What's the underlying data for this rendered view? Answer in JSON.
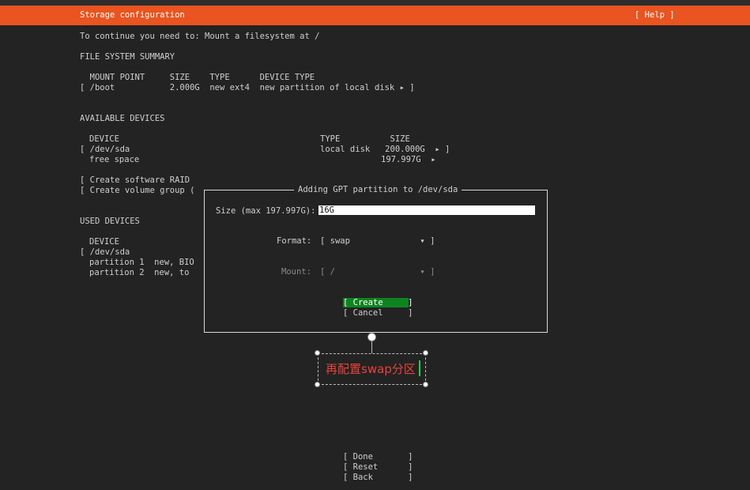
{
  "header": {
    "title": "Storage configuration",
    "help": "[ Help ]"
  },
  "message": "To continue you need to: Mount a filesystem at /",
  "fs_summary": {
    "heading": "FILE SYSTEM SUMMARY",
    "columns": "  MOUNT POINT     SIZE    TYPE      DEVICE TYPE",
    "rows": [
      "[ /boot           2.000G  new ext4  new partition of local disk ▸ ]"
    ]
  },
  "available": {
    "heading": "AVAILABLE DEVICES",
    "col_device": "DEVICE",
    "col_type_size": "TYPE          SIZE",
    "dev_name": "[ /dev/sda",
    "dev_info": "local disk   200.000G  ▸ ]",
    "free_name": "free space",
    "free_info": "197.997G  ▸",
    "raid": "[ Create software RAID",
    "vg": "[ Create volume group ("
  },
  "used": {
    "heading": "USED DEVICES",
    "col_device": "DEVICE",
    "dev": "[ /dev/sda",
    "p1": "partition 1  new, BIO",
    "p2": "partition 2  new, to"
  },
  "dialog": {
    "title": "Adding GPT partition to /dev/sda",
    "size_label": "Size (max 197.997G):",
    "size_value": "16G",
    "format_label": "Format:",
    "format_value": "[ swap              ▾ ]",
    "mount_label": "Mount:",
    "mount_value": "[ /                 ▾ ]",
    "create": "[ Create     ]",
    "cancel": "[ Cancel     ]"
  },
  "annotation": {
    "text": "再配置swap分区"
  },
  "footer": {
    "done": "[ Done       ]",
    "reset": "[ Reset      ]",
    "back": "[ Back       ]"
  }
}
